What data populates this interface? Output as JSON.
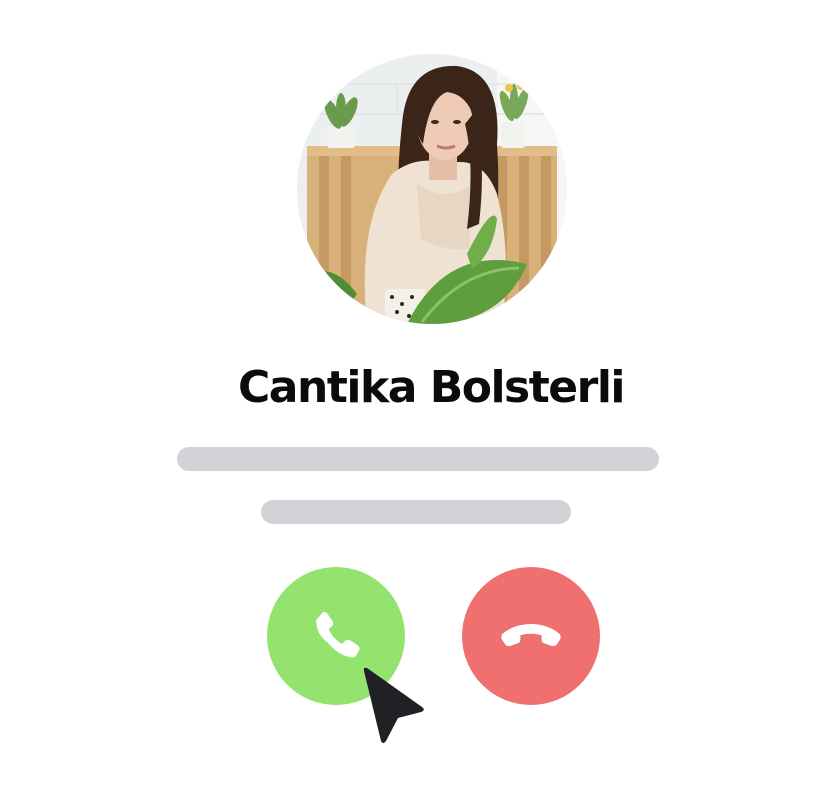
{
  "caller": {
    "name": "Cantika Bolsterli"
  },
  "actions": {
    "accept_icon": "phone-icon",
    "decline_icon": "phone-hangup-icon"
  },
  "colors": {
    "accept": "#94e36f",
    "decline": "#f07070",
    "placeholder_bar": "#d2d3d6",
    "name_text": "#0b0b0b",
    "cursor": "#1f2124"
  }
}
